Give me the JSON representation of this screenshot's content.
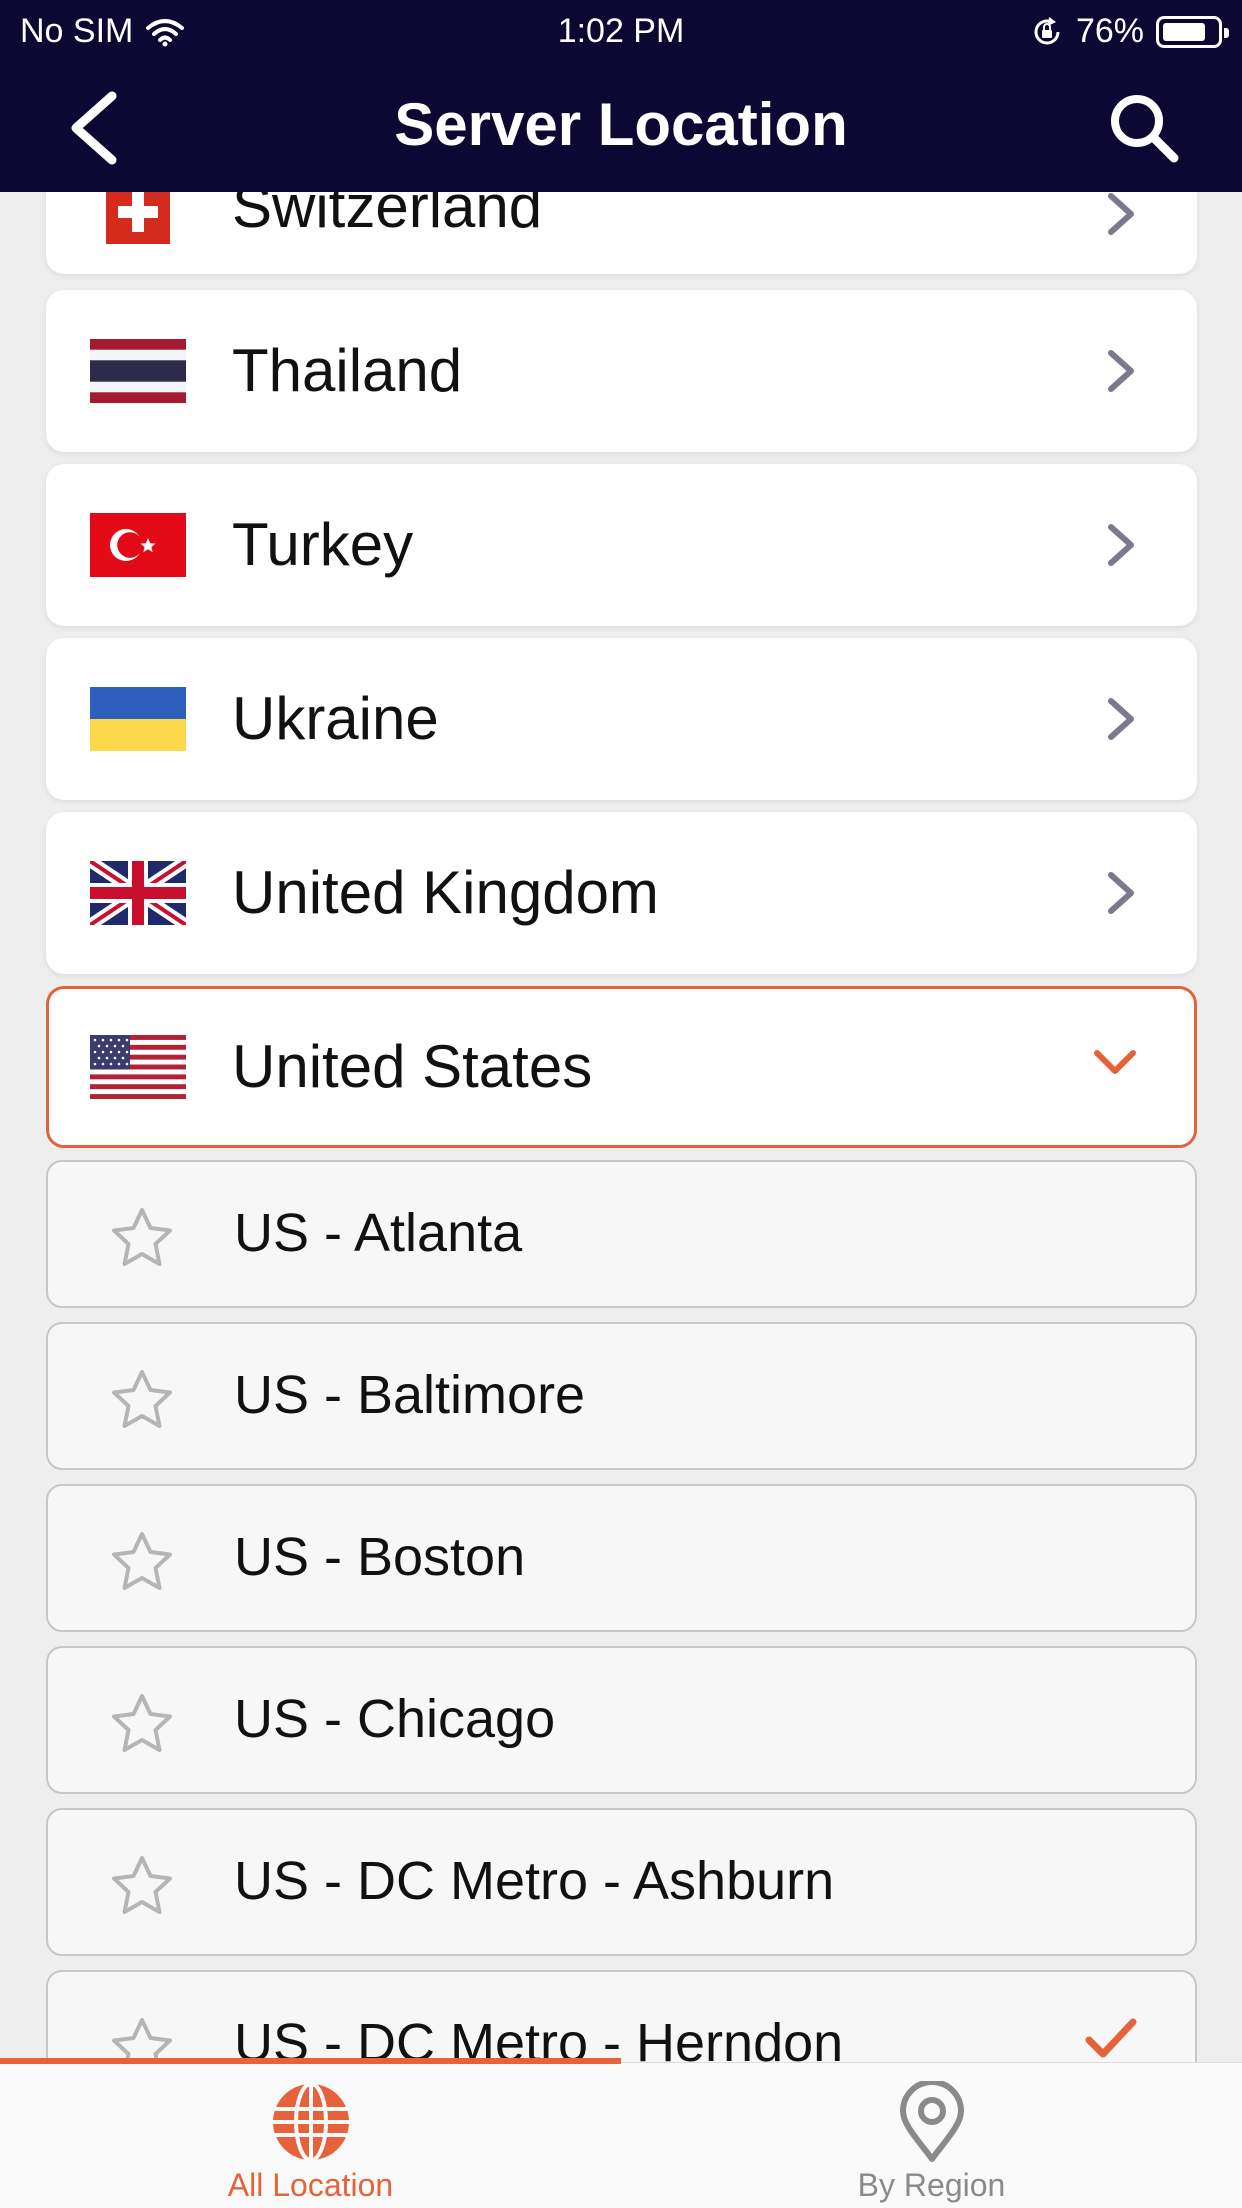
{
  "status_bar": {
    "carrier": "No SIM",
    "time": "1:02 PM",
    "battery": "76%"
  },
  "header": {
    "title": "Server Location"
  },
  "countries": [
    {
      "name": "Switzerland",
      "flag": "switzerland"
    },
    {
      "name": "Thailand",
      "flag": "thailand"
    },
    {
      "name": "Turkey",
      "flag": "turkey"
    },
    {
      "name": "Ukraine",
      "flag": "ukraine"
    },
    {
      "name": "United Kingdom",
      "flag": "united-kingdom"
    },
    {
      "name": "United States",
      "flag": "united-states",
      "expanded": true
    }
  ],
  "cities": [
    {
      "name": "US - Atlanta",
      "favorite": false,
      "selected": false
    },
    {
      "name": "US - Baltimore",
      "favorite": false,
      "selected": false
    },
    {
      "name": "US - Boston",
      "favorite": false,
      "selected": false
    },
    {
      "name": "US - Chicago",
      "favorite": false,
      "selected": false
    },
    {
      "name": "US - DC Metro - Ashburn",
      "favorite": false,
      "selected": false
    },
    {
      "name": "US - DC Metro - Herndon",
      "favorite": false,
      "selected": true
    }
  ],
  "tabs": [
    {
      "label": "All Location",
      "icon": "globe-icon",
      "active": true
    },
    {
      "label": "By Region",
      "icon": "map-pin-icon",
      "active": false
    }
  ],
  "colors": {
    "header_bg": "#0d0833",
    "accent": "#e5623a",
    "chevron": "#7a7a8c",
    "star": "#b5b5b5"
  }
}
